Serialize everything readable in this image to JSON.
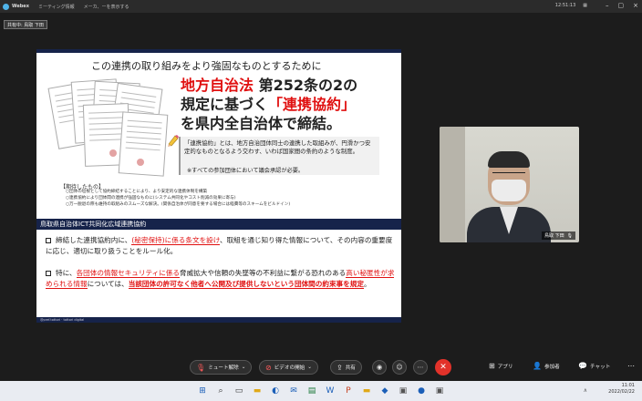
{
  "window": {
    "app_name": "Webex",
    "breadcrumb_1": "ミーティング情報",
    "breadcrumb_2": "メーカ、ーを表示する",
    "status_right": "12:51:13"
  },
  "share_badge": "共有中: 鳥取 下田",
  "slide": {
    "title": "この連携の取り組みをより強固なものとするために",
    "big_line1_red": "地方自治法",
    "big_line1_rest": " 第252条の2の",
    "big_line2_pre": "規定に基づく",
    "big_line2_red": "「連携協約」",
    "big_line3": "を県内全自治体で締結。",
    "definition": "「連携協約」とは、地方自治団体同士の連携した取組みが、円滑かつ安定的なものとなるよう交わす、いわば国家間の条約のような制度。",
    "definition_note": "※すべての参加団体において議会承認が必要。",
    "expect_title": "【期待したもの】",
    "expect_items": [
      "○団体の垣根として協約締結することにより、より安定的な連携体制を構築",
      "○連携協約により団体間の連携が強固なものに(システム共同化やコスト削減の効果に寄与)",
      "○万一脱退の際も維持の取組みのスムーズな解決。(関係自治体が同意を要する場合には経費等のスキームをビルドイン)"
    ],
    "band_title": "鳥取県自治体ICT共同化広域連携協約",
    "point1_pre": "締結した連携協約内に、",
    "point1_red": "(秘密保持)に係る条文を設け",
    "point1_post": "、取組を通じ知り得た情報について、その内容の重要度に応じ、適切に取り扱うことをルール化。",
    "point2_pre": "特に、",
    "point2_red1": "各団体の情報セキュリティに係る",
    "point2_mid": "脅威拡大や信頼の失墜等の不利益に繋がる恐れのある",
    "point2_red2": "高い秘匿性が求められる情報",
    "point2_mid2": "については、",
    "point2_redb": "当該団体の許可なく他者へ公開及び提供しないという団体間の約束事を規定",
    "point2_end": "。",
    "footer": "@pref.tottori  ·  tottori digital"
  },
  "video": {
    "name_label": "鳥取 下田",
    "mic_icon": "mic-icon"
  },
  "controls": {
    "mute_label": "ミュート解除",
    "video_label": "ビデオの開始",
    "share_label": "共有",
    "apps_label": "アプリ",
    "participants_label": "参加者",
    "chat_label": "チャット"
  },
  "taskbar": {
    "time": "11:01",
    "date": "2022/02/22"
  }
}
